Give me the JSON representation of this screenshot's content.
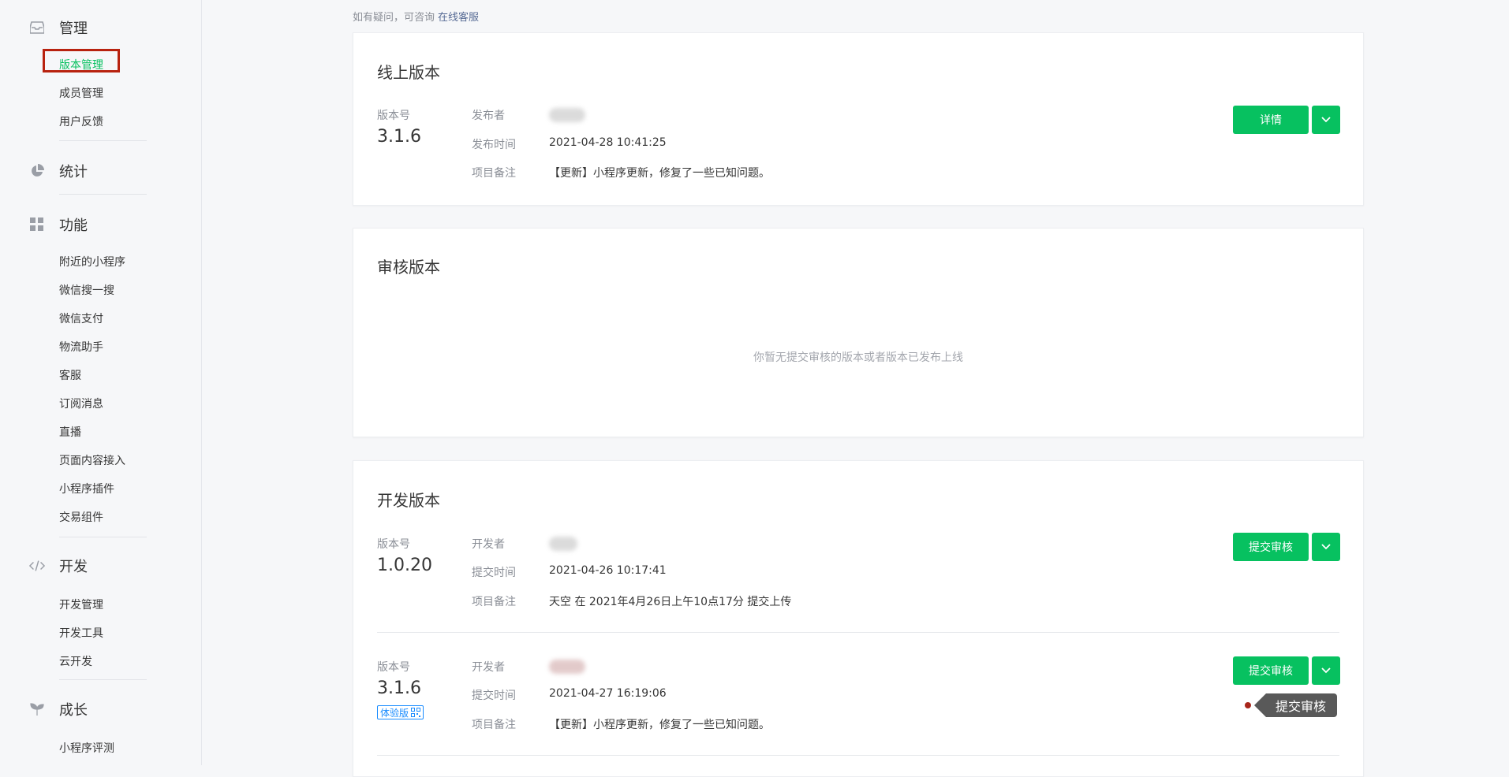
{
  "sidebar": {
    "groups": [
      {
        "title": "管理",
        "icon": "inbox-icon",
        "items": [
          "版本管理",
          "成员管理",
          "用户反馈"
        ]
      },
      {
        "title": "统计",
        "icon": "pie-chart-icon",
        "items": []
      },
      {
        "title": "功能",
        "icon": "grid-icon",
        "items": [
          "附近的小程序",
          "微信搜一搜",
          "微信支付",
          "物流助手",
          "客服",
          "订阅消息",
          "直播",
          "页面内容接入",
          "小程序插件",
          "交易组件"
        ]
      },
      {
        "title": "开发",
        "icon": "code-icon",
        "items": [
          "开发管理",
          "开发工具",
          "云开发"
        ]
      },
      {
        "title": "成长",
        "icon": "sprout-icon",
        "items": [
          "小程序评测"
        ]
      }
    ],
    "active_item": "版本管理"
  },
  "help": {
    "text": "如有疑问，可咨询",
    "link": "在线客服"
  },
  "online": {
    "title": "线上版本",
    "version_label": "版本号",
    "version": "3.1.6",
    "publisher_label": "发布者",
    "time_label": "发布时间",
    "time": "2021-04-28 10:41:25",
    "note_label": "项目备注",
    "note": "【更新】小程序更新，修复了一些已知问题。",
    "detail_button": "详情"
  },
  "review": {
    "title": "审核版本",
    "empty": "你暂无提交审核的版本或者版本已发布上线"
  },
  "dev": {
    "title": "开发版本",
    "rows": [
      {
        "version_label": "版本号",
        "version": "1.0.20",
        "dev_label": "开发者",
        "time_label": "提交时间",
        "time": "2021-04-26 10:17:41",
        "note_label": "项目备注",
        "note": "天空 在 2021年4月26日上午10点17分 提交上传",
        "submit_button": "提交审核"
      },
      {
        "version_label": "版本号",
        "version": "3.1.6",
        "badge": "体验版",
        "dev_label": "开发者",
        "time_label": "提交时间",
        "time": "2021-04-27 16:19:06",
        "note_label": "项目备注",
        "note": "【更新】小程序更新，修复了一些已知问题。",
        "submit_button": "提交审核",
        "tooltip": "提交审核"
      }
    ]
  },
  "colors": {
    "primary": "#07c160",
    "highlight": "#b8220f",
    "link": "#576b95"
  }
}
